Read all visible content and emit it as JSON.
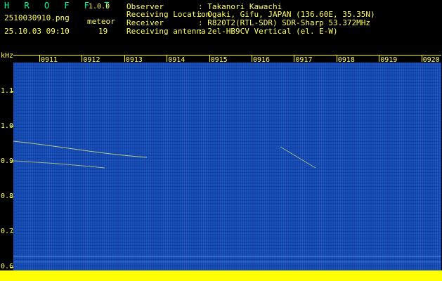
{
  "header": {
    "app_name": "H R O F F T",
    "version": "1.0.0",
    "filename": "2510030910.png",
    "meteor_label": "meteor",
    "date_time": "25.10.03 09:10",
    "meteor_count": "19"
  },
  "info": [
    {
      "label": "Observer",
      "value": ": Takanori Kawachi"
    },
    {
      "label": "Receiving Location",
      "value": ": Ogaki, Gifu, JAPAN (136.60E, 35.35N)"
    },
    {
      "label": "Receiver",
      "value": ": R820T2(RTL-SDR) SDR-Sharp 53.372MHz"
    },
    {
      "label": "Receiving antenna",
      "value": ": 2el-HB9CV Vertical (el. E-W)"
    }
  ],
  "axis": {
    "y_unit": "kHz",
    "y_ticks": [
      "1.1",
      "1.0",
      "0.9",
      "0.8",
      "0.7",
      "0.6"
    ],
    "x_ticks": [
      "0911",
      "0912",
      "0913",
      "0914",
      "0915",
      "0916",
      "0917",
      "0918",
      "0919",
      "0920"
    ]
  },
  "colors": {
    "background": "#000000",
    "spectrogram": "#1a46b0",
    "text": "#ffff66",
    "logo": "#00ffa0",
    "baseline": "#ffff00"
  }
}
